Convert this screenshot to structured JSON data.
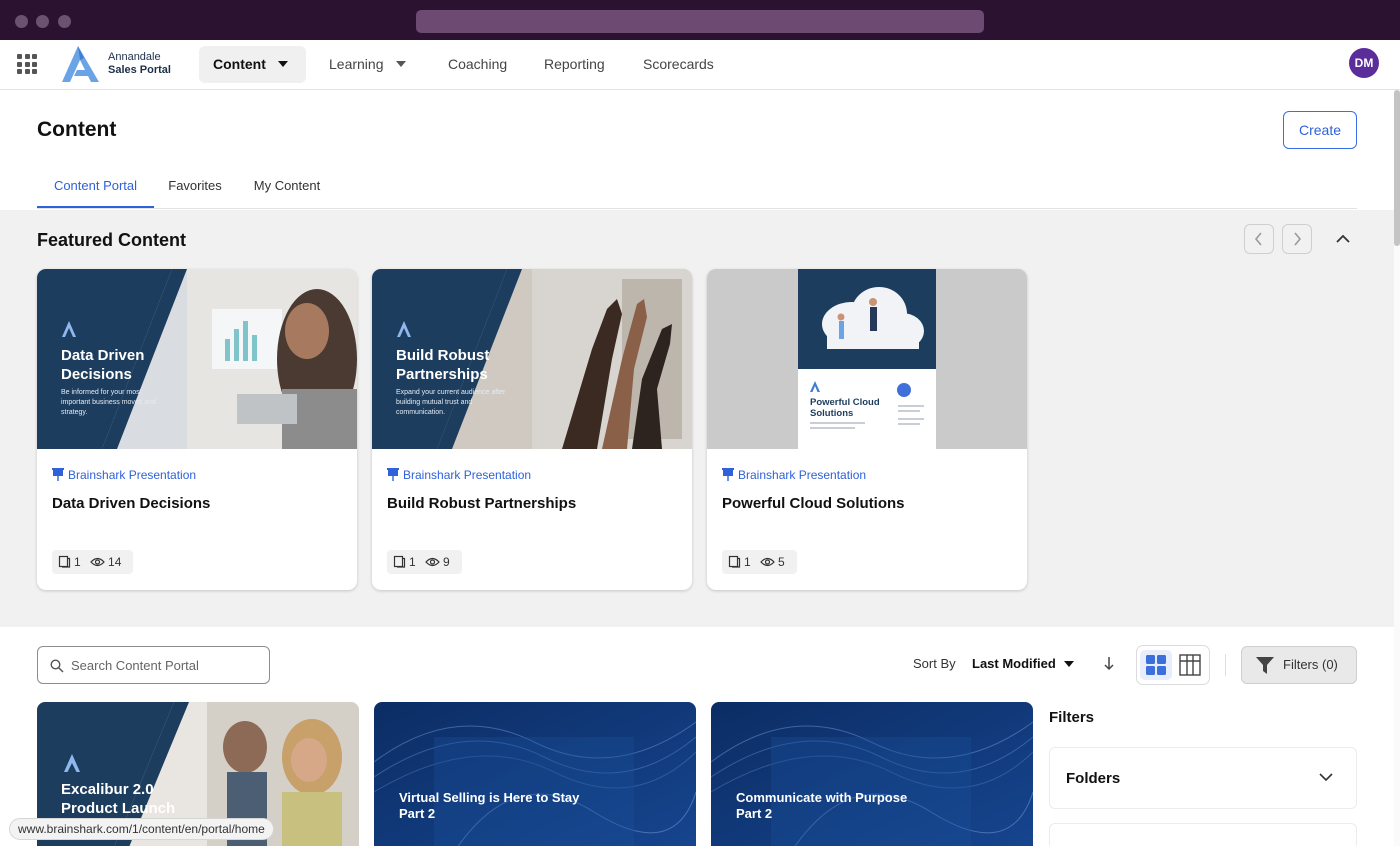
{
  "browser": {
    "status_url": "www.brainshark.com/1/content/en/portal/home"
  },
  "nav": {
    "logo_line1": "Annandale",
    "logo_line2": "Sales Portal",
    "items": [
      {
        "label": "Content",
        "dropdown": true,
        "active": true
      },
      {
        "label": "Learning",
        "dropdown": true,
        "active": false
      },
      {
        "label": "Coaching",
        "dropdown": false,
        "active": false
      },
      {
        "label": "Reporting",
        "dropdown": false,
        "active": false
      },
      {
        "label": "Scorecards",
        "dropdown": false,
        "active": false
      }
    ],
    "avatar_initials": "DM"
  },
  "page": {
    "title": "Content",
    "create_label": "Create",
    "tabs": [
      {
        "label": "Content Portal",
        "active": true
      },
      {
        "label": "Favorites",
        "active": false
      },
      {
        "label": "My Content",
        "active": false
      }
    ]
  },
  "featured": {
    "title": "Featured Content",
    "cards": [
      {
        "type": "Brainshark Presentation",
        "title": "Data Driven Decisions",
        "thumb_title": "Data Driven Decisions",
        "thumb_subtitle": "Be informed for your most important business moves and strategy.",
        "slides": "1",
        "views": "14"
      },
      {
        "type": "Brainshark Presentation",
        "title": "Build Robust Partnerships",
        "thumb_title": "Build Robust Partnerships",
        "thumb_subtitle": "Expand your current audience after building mutual trust and communication.",
        "slides": "1",
        "views": "9"
      },
      {
        "type": "Brainshark Presentation",
        "title": "Powerful Cloud Solutions",
        "thumb_title": "Powerful Cloud Solutions",
        "slides": "1",
        "views": "5"
      }
    ]
  },
  "toolbar": {
    "search_placeholder": "Search Content Portal",
    "sort_label": "Sort By",
    "sort_value": "Last Modified",
    "filters_label": "Filters (0)"
  },
  "grid": {
    "cards": [
      {
        "thumb_title": "Excalibur 2.0 Product Launch"
      },
      {
        "thumb_title": "Virtual Selling is Here to Stay Part 2"
      },
      {
        "thumb_title": "Communicate with Purpose Part 2"
      }
    ]
  },
  "filters_panel": {
    "heading": "Filters",
    "folders_label": "Folders"
  },
  "colors": {
    "titlebar": "#2b1231",
    "accent": "#2f62d9",
    "navy": "#1d3d5e",
    "avatar": "#5b2d9a"
  }
}
